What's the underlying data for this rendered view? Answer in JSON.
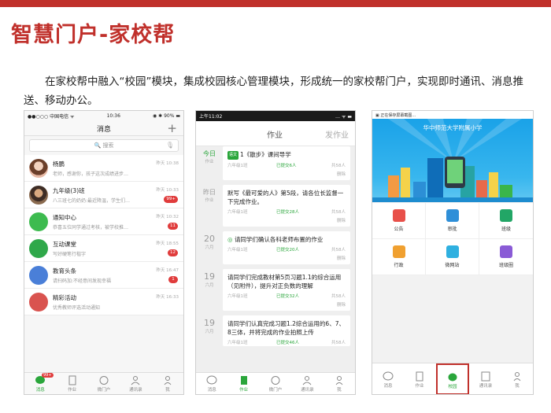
{
  "slide": {
    "title": "智慧门户-家校帮",
    "subtitle": "在家校帮中融入“校园”模块，集成校园核心管理模块，形成统一的家校帮门户，实现即时通讯、消息推送、移动办公。"
  },
  "phone1": {
    "status": {
      "carrier": "●●○○○ 中国电信 ᯤ",
      "time": "10:36",
      "battery": "◉ ✱ 90% ▬"
    },
    "nav_title": "消息",
    "search_placeholder": "🔍 搜索",
    "messages": [
      {
        "name": "杨鹏",
        "preview": "老师，感谢你，孩子这次成绩进步…",
        "time": "昨天 10:38",
        "badge": ""
      },
      {
        "name": "九年级(3)班",
        "preview": "八三班七的奶奶:最近降温，学生们…",
        "time": "昨天 10:33",
        "badge": "99+"
      },
      {
        "name": "通知中心",
        "preview": "恭喜五位同学通过考核，被学校推…",
        "time": "昨天 10:32",
        "badge": "11"
      },
      {
        "name": "互动课堂",
        "preview": "写好硬笔行楷字",
        "time": "昨天 18:55",
        "badge": "12"
      },
      {
        "name": "教育头条",
        "preview": "请扫码加:不经意间发现幸福",
        "time": "昨天 16:47",
        "badge": "1"
      },
      {
        "name": "精彩活动",
        "preview": "优秀教师评选活动通知",
        "time": "昨天 16:33",
        "badge": ""
      }
    ],
    "tabs": [
      {
        "label": "消息",
        "badge": "99+"
      },
      {
        "label": "作业"
      },
      {
        "label": "微门户"
      },
      {
        "label": "通讯录"
      },
      {
        "label": "我"
      }
    ]
  },
  "phone2": {
    "status": {
      "time": "上午11:02",
      "icons": "… ᯤ ▬"
    },
    "header": {
      "active": "作业",
      "other": "发作业"
    },
    "items": [
      {
        "date": "今日",
        "date_sub": "作业",
        "tag": "语文",
        "text": "1《散步》课间导学",
        "cls": "六年级1班",
        "submitted": "已提交6人",
        "total": "共58人",
        "delete": "删除",
        "today": true
      },
      {
        "date": "昨日",
        "date_sub": "作业",
        "tag": "",
        "text": "默写《最可爱的人》第5段，请各位长监督一下完成作业。",
        "cls": "六年级1班",
        "submitted": "已提交28人",
        "total": "共58人",
        "delete": "删除"
      },
      {
        "date": "20",
        "date_sub": "六月",
        "tag": "◎",
        "text": "请同学们确认各科老师布置的作业",
        "cls": "六年级1班",
        "submitted": "已提交20人",
        "total": "共58人",
        "delete": "删除"
      },
      {
        "date": "19",
        "date_sub": "六月",
        "tag": "",
        "text": "请同学们完成教材第5页习题1.1的综合运用（见附件），提升对正负数的理解",
        "cls": "六年级1班",
        "submitted": "已提交32人",
        "total": "共58人",
        "delete": "删除"
      },
      {
        "date": "19",
        "date_sub": "六月",
        "tag": "",
        "text": "请同学们认真完成习题1.2综合运用的6、7、8三体，并将完成的作业拍照上传",
        "cls": "六年级1班",
        "submitted": "已提交46人",
        "total": "共58人",
        "delete": ""
      }
    ],
    "tabs": [
      {
        "label": "消息"
      },
      {
        "label": "作业"
      },
      {
        "label": "微门户"
      },
      {
        "label": "通讯录"
      },
      {
        "label": "我"
      }
    ]
  },
  "phone3": {
    "status": "▣ 正在保存屏幕截图…",
    "school": "华中师范大学附属小学",
    "modules": [
      {
        "label": "公告",
        "color": "#e8504a"
      },
      {
        "label": "审批",
        "color": "#2f8fd8"
      },
      {
        "label": "班级",
        "color": "#22a666"
      },
      {
        "label": "行政",
        "color": "#f0a030"
      },
      {
        "label": "微网站",
        "color": "#2fb0e0"
      },
      {
        "label": "班级圈",
        "color": "#8a5bd6"
      }
    ],
    "tabs": [
      {
        "label": "消息"
      },
      {
        "label": "作业"
      },
      {
        "label": "校园"
      },
      {
        "label": "通讯录"
      },
      {
        "label": "我"
      }
    ]
  }
}
